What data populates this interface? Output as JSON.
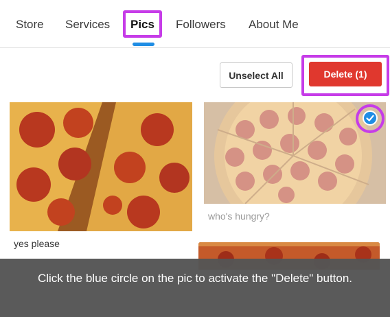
{
  "tabs": [
    {
      "label": "Store"
    },
    {
      "label": "Services"
    },
    {
      "label": "Pics"
    },
    {
      "label": "Followers"
    },
    {
      "label": "About Me"
    }
  ],
  "active_tab": "Pics",
  "actions": {
    "unselect_label": "Unselect All",
    "delete_label": "Delete  (1)"
  },
  "photos": [
    {
      "caption": "yes please",
      "selected": false
    },
    {
      "caption": "who's hungry?",
      "selected": true
    },
    {
      "caption": "",
      "selected": false
    }
  ],
  "instruction": "Click the blue circle on the pic to activate the \"Delete\" button.",
  "colors": {
    "accent": "#1f8de4",
    "delete": "#e0382e",
    "highlight": "#c63ce8",
    "tooltip_bg": "#555555"
  },
  "icons": {
    "selected_marker": "check-circle-icon"
  }
}
